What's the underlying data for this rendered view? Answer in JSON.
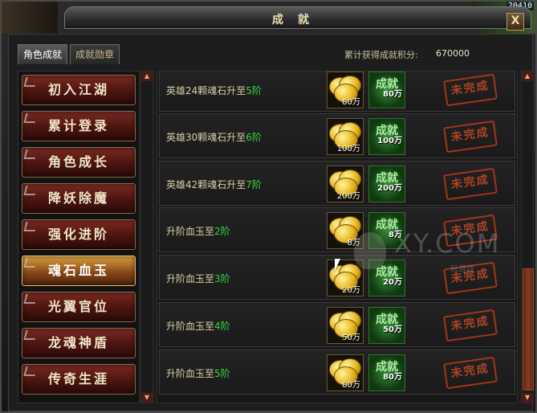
{
  "corner_number": "20410",
  "window": {
    "title": "成就",
    "close_label": "X"
  },
  "tabs": [
    {
      "label": "角色成就",
      "active": true
    },
    {
      "label": "成就勋章",
      "active": false
    }
  ],
  "score": {
    "label": "累计获得成就积分:",
    "value": "670000"
  },
  "categories": [
    {
      "label": "初入江湖",
      "selected": false
    },
    {
      "label": "累计登录",
      "selected": false
    },
    {
      "label": "角色成长",
      "selected": false
    },
    {
      "label": "降妖除魔",
      "selected": false
    },
    {
      "label": "强化进阶",
      "selected": false
    },
    {
      "label": "魂石血玉",
      "selected": true
    },
    {
      "label": "光翼官位",
      "selected": false
    },
    {
      "label": "龙魂神盾",
      "selected": false
    },
    {
      "label": "传奇生涯",
      "selected": false
    }
  ],
  "achievements": [
    {
      "prefix": "英雄24颗魂石升至",
      "level": "5阶",
      "gold_amount": "80万",
      "badge_label": "成就",
      "badge_amount": "80万",
      "status": "未完成"
    },
    {
      "prefix": "英雄30颗魂石升至",
      "level": "6阶",
      "gold_amount": "100万",
      "badge_label": "成就",
      "badge_amount": "100万",
      "status": "未完成"
    },
    {
      "prefix": "英雄42颗魂石升至",
      "level": "7阶",
      "gold_amount": "200万",
      "badge_label": "成就",
      "badge_amount": "200万",
      "status": "未完成"
    },
    {
      "prefix": "升阶血玉至",
      "level": "2阶",
      "gold_amount": "8万",
      "badge_label": "成就",
      "badge_amount": "8万",
      "status": "未完成"
    },
    {
      "prefix": "升阶血玉至",
      "level": "3阶",
      "gold_amount": "20万",
      "badge_label": "成就",
      "badge_amount": "20万",
      "status": "未完成"
    },
    {
      "prefix": "升阶血玉至",
      "level": "4阶",
      "gold_amount": "50万",
      "badge_label": "成就",
      "badge_amount": "50万",
      "status": "未完成"
    },
    {
      "prefix": "升阶血玉至",
      "level": "5阶",
      "gold_amount": "80万",
      "badge_label": "成就",
      "badge_amount": "80万",
      "status": "未完成"
    }
  ],
  "watermark": {
    "text": "XY.COM",
    "sub": "玩游戏"
  }
}
